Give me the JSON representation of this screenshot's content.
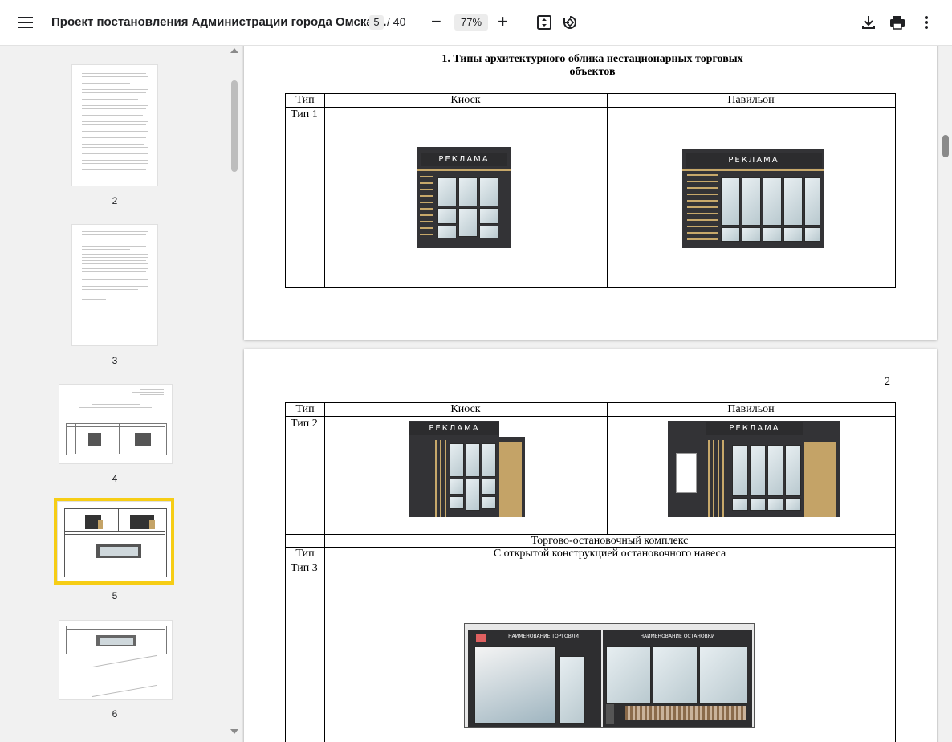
{
  "toolbar": {
    "title": "Проект постановления Администрации города Омска ...",
    "page_current": "5",
    "page_total": "/ 40",
    "zoom_out": "−",
    "zoom": "77%",
    "zoom_in": "+"
  },
  "sidebar": {
    "thumbnails": [
      {
        "label": "2"
      },
      {
        "label": "3"
      },
      {
        "label": "4"
      },
      {
        "label": "5"
      },
      {
        "label": "6"
      }
    ],
    "selected": "5"
  },
  "page1": {
    "heading_line1": "1. Типы архитектурного облика нестационарных торговых",
    "heading_line2": "объектов",
    "col_type": "Тип",
    "col_kiosk": "Киоск",
    "col_pavilion": "Павильон",
    "row1_type": "Тип 1"
  },
  "page2": {
    "page_number": "2",
    "col_type": "Тип",
    "col_kiosk": "Киоск",
    "col_pavilion": "Павильон",
    "row2_type": "Тип 2",
    "complex_title": "Торгово-остановочный комплекс",
    "col_type2": "Тип",
    "complex_desc": "С открытой конструкцией остановочного навеса",
    "row3_type": "Тип 3",
    "stop_sign_left": "НАИМЕНОВАНИЕ ТОРГОВЛИ",
    "stop_sign_right": "НАИМЕНОВАНИЕ ОСТАНОВКИ"
  },
  "signs": {
    "advert": "РЕКЛАМА"
  },
  "colors": {
    "highlight": "#f6cd15",
    "accent_gold": "#c4a367",
    "dark": "#333336"
  }
}
